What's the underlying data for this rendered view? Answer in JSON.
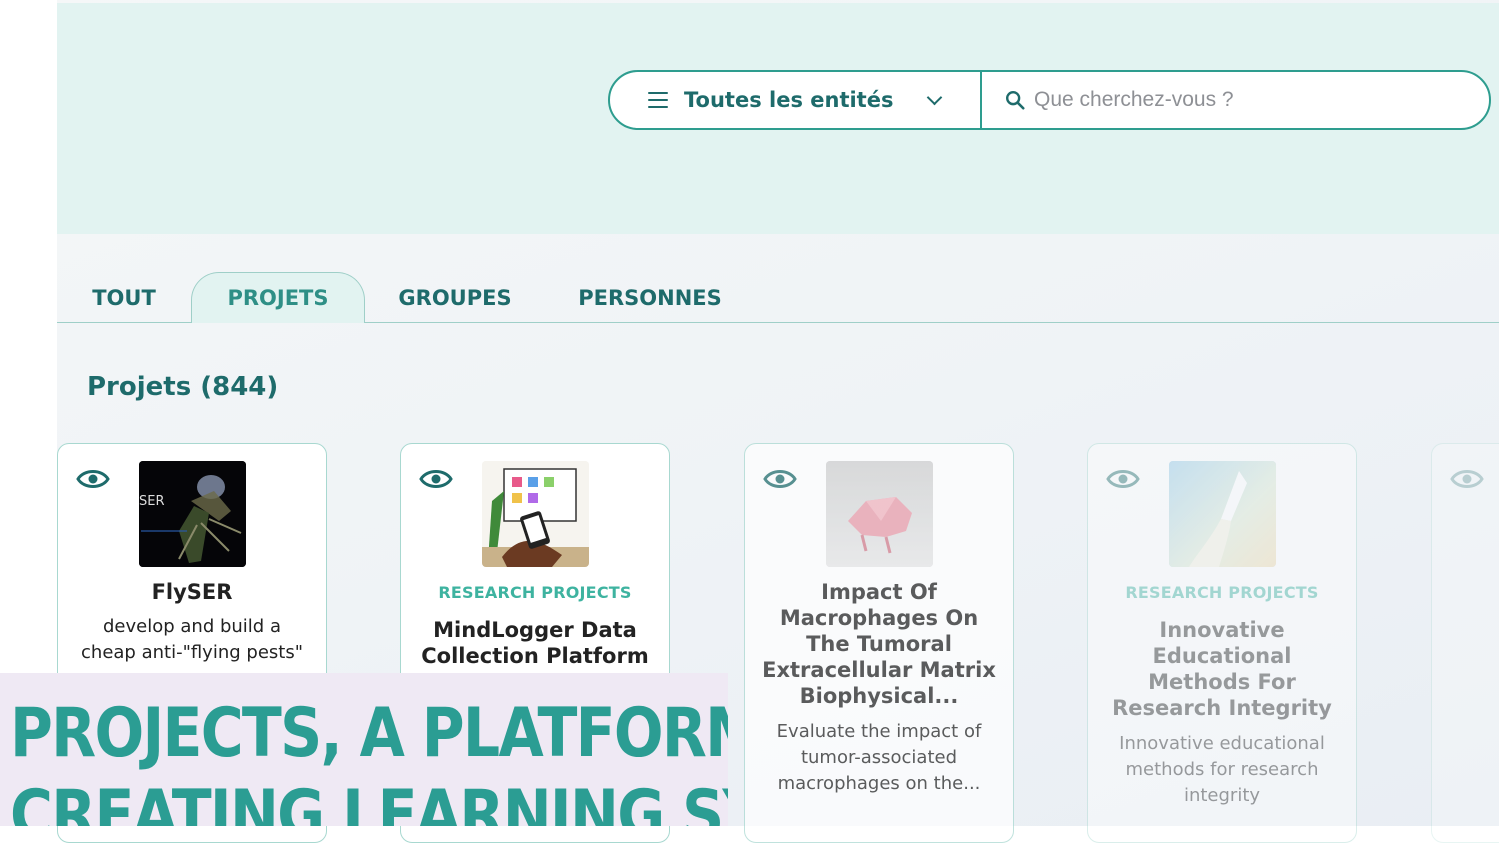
{
  "search": {
    "entity_select_label": "Toutes les entités",
    "placeholder": "Que cherchez-vous ?"
  },
  "tabs": [
    {
      "label": "TOUT",
      "active": false
    },
    {
      "label": "PROJETS",
      "active": true
    },
    {
      "label": "GROUPES",
      "active": false
    },
    {
      "label": "PERSONNES",
      "active": false
    }
  ],
  "section": {
    "title": "Projets (844)"
  },
  "cards": [
    {
      "category": "",
      "title": "FlySER",
      "description": "develop and build a cheap anti-\"flying pests\"",
      "thumb_text": "SER"
    },
    {
      "category": "RESEARCH PROJECTS",
      "title": "MindLogger Data Collection Platform",
      "description": ""
    },
    {
      "category": "",
      "title": "Impact Of Macrophages On The Tumoral Extracellular Matrix Biophysical...",
      "description": "Evaluate the impact of tumor-associated macrophages on the..."
    },
    {
      "category": "RESEARCH PROJECTS",
      "title": "Innovative Educational Methods For Research Integrity",
      "description": "Innovative educational methods for research integrity"
    }
  ],
  "overlay": {
    "line1": "PROJECTS, A PLATFORM FOR",
    "line2": "CREATING LEARNING SYSTEMS"
  },
  "colors": {
    "accent": "#2e9d8f",
    "primary_text": "#1e6b6b",
    "category": "#3eb3a0",
    "hero_bg": "#e2f3f1"
  }
}
